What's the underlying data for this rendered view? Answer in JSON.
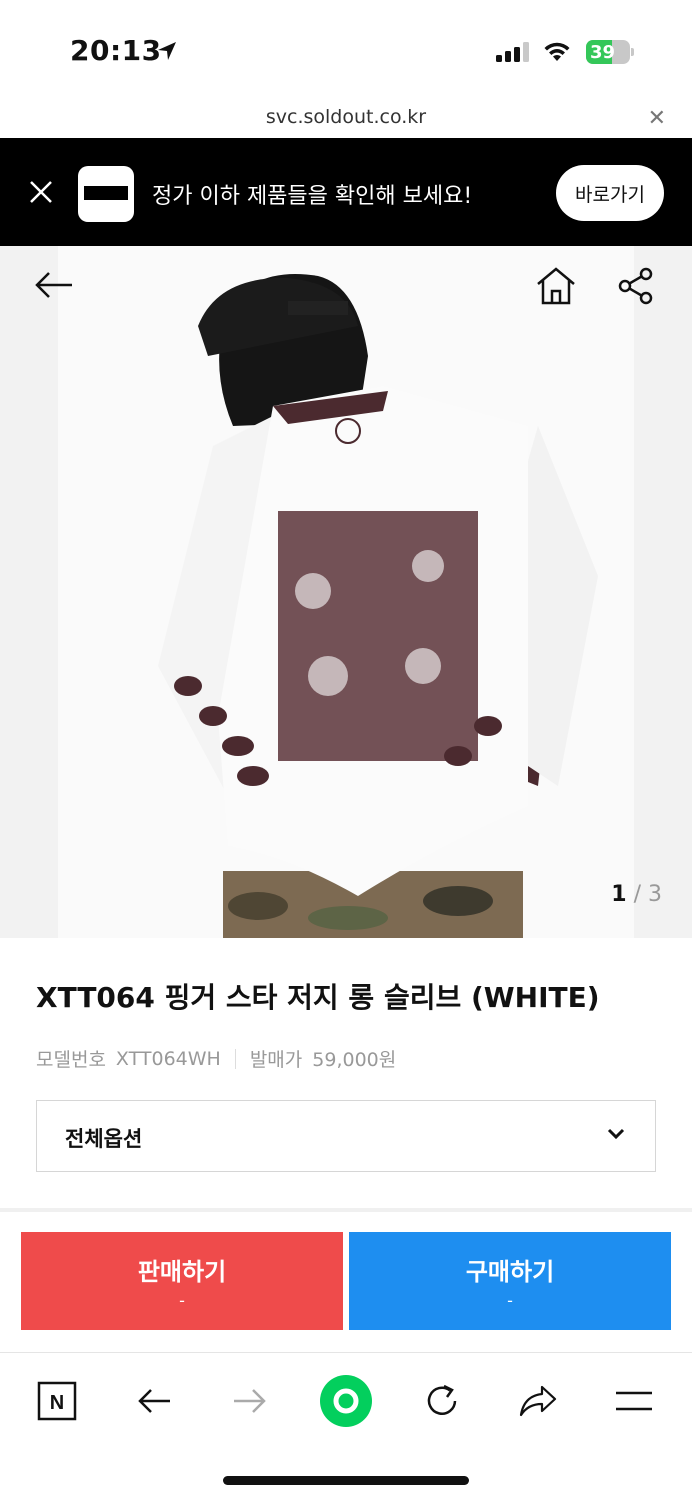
{
  "status_bar": {
    "time": "20:13",
    "battery": "39"
  },
  "browser": {
    "url": "svc.soldout.co.kr"
  },
  "banner": {
    "message": "정가 이하 제품들을 확인해 보세요!",
    "button_label": "바로가기"
  },
  "gallery": {
    "current": "1",
    "separator": "/",
    "total": "3"
  },
  "product": {
    "title": "XTT064 핑거 스타 저지 롱 슬리브 (WHITE)",
    "model_label": "모델번호",
    "model_value": "XTT064WH",
    "price_label": "발매가",
    "price_value": "59,000원",
    "option_label": "전체옵션"
  },
  "actions": {
    "sell_label": "판매하기",
    "sell_sub": "-",
    "buy_label": "구매하기",
    "buy_sub": "-"
  },
  "colors": {
    "sell": "#ef4b4b",
    "buy": "#1e8ef0",
    "battery": "#34c759",
    "naver_green": "#03cf5d"
  },
  "toolbar": {
    "naver_icon_letter": "N"
  }
}
